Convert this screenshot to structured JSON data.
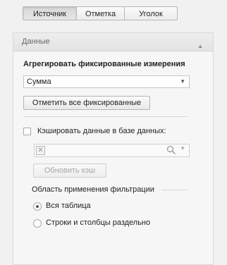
{
  "tabs": [
    {
      "label": "Источник",
      "active": true
    },
    {
      "label": "Отметка",
      "active": false
    },
    {
      "label": "Уголок",
      "active": false
    }
  ],
  "panel": {
    "header": "Данные",
    "section_title": "Агрегировать фиксированные измерения",
    "aggregation_select": {
      "value": "Сумма"
    },
    "mark_all_button": "Отметить все фиксированные",
    "cache_checkbox": {
      "label": "Кэшировать данные в базе данных:",
      "checked": false
    },
    "cache_combo": {
      "value": ""
    },
    "refresh_cache_button": "Обновить кэш",
    "filter_scope": {
      "label": "Область применения фильтрации",
      "options": [
        {
          "label": "Вся таблица",
          "checked": true
        },
        {
          "label": "Строки и столбцы раздельно",
          "checked": false
        }
      ]
    }
  },
  "icons": {
    "collapse": "chevron-up-icon",
    "dropdown": "chevron-down-icon",
    "search": "search-icon",
    "clear": "close-icon"
  }
}
